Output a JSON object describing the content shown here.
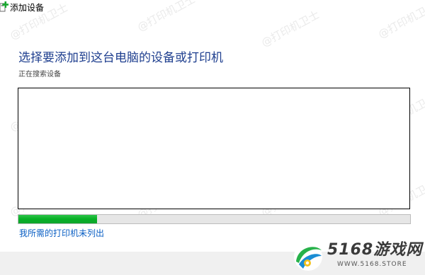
{
  "window": {
    "title": "添加设备"
  },
  "main": {
    "heading": "选择要添加到这台电脑的设备或打印机",
    "status_text": "正在搜索设备",
    "progress": 0.2,
    "link_label": "我所需的打印机未列出"
  },
  "watermark": {
    "text": "@打印机卫士"
  },
  "site_logo": {
    "name": "5168游戏网",
    "url": "WWW.5168.STORE"
  },
  "colors": {
    "heading": "#1f3f8f",
    "link": "#0a5fc4",
    "progress": "#06b025",
    "footer": "#f0f0f0"
  }
}
